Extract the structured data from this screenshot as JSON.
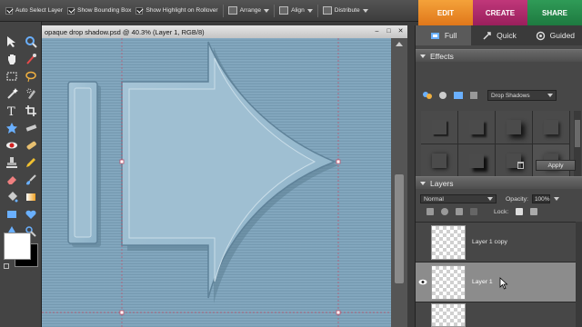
{
  "options_bar": {
    "auto_select_layer": "Auto Select Layer",
    "show_bounding_box": "Show Bounding Box",
    "show_highlight": "Show Highlight on Rollover",
    "arrange": "Arrange",
    "align": "Align",
    "distribute": "Distribute"
  },
  "mode_tabs": {
    "edit": "EDIT",
    "create": "CREATE",
    "share": "SHARE",
    "active": "EDIT"
  },
  "document": {
    "title": "opaque drop shadow.psd @ 40.3% (Layer 1, RGB/8)"
  },
  "view_tabs": {
    "full": "Full",
    "quick": "Quick",
    "guided": "Guided",
    "active": "Full"
  },
  "effects": {
    "title": "Effects",
    "dropdown_value": "Drop Shadows",
    "apply_label": "Apply"
  },
  "layers": {
    "title": "Layers",
    "blend_mode": "Normal",
    "opacity_label": "Opacity:",
    "opacity_value": "100%",
    "lock_label": "Lock:",
    "items": [
      {
        "name": "Layer 1 copy",
        "visible": false,
        "selected": false
      },
      {
        "name": "Layer 1",
        "visible": true,
        "selected": true
      }
    ]
  },
  "colors": {
    "edit_tab": "#e88a26",
    "create_tab": "#b02d6c",
    "share_tab": "#2a8c4c",
    "canvas_bg": "#7fa4ba",
    "foreground_color": "#ffffff",
    "background_color": "#000000"
  }
}
